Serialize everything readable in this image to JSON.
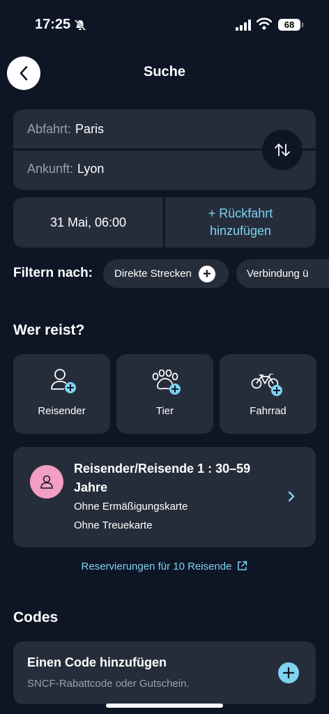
{
  "status_bar": {
    "time": "17:25",
    "battery": "68"
  },
  "header": {
    "title": "Suche"
  },
  "route": {
    "departure_label": "Abfahrt:",
    "departure_value": "Paris",
    "arrival_label": "Ankunft:",
    "arrival_value": "Lyon"
  },
  "date": {
    "outbound": "31 Mai, 06:00",
    "return_line1": "+ Rückfahrt",
    "return_line2": "hinzufügen"
  },
  "filters": {
    "label": "Filtern nach:",
    "chips": [
      "Direkte Strecken",
      "Verbindung ü"
    ]
  },
  "who": {
    "title": "Wer reist?",
    "options": [
      "Reisender",
      "Tier",
      "Fahrrad"
    ]
  },
  "traveler": {
    "name": "Reisender/Reisende 1 : 30–59 Jahre",
    "card1": "Ohne Ermäßigungskarte",
    "card2": "Ohne Treuekarte"
  },
  "reservation_link": "Reservierungen für 10 Reisende",
  "codes": {
    "title": "Codes",
    "add_title": "Einen Code hinzufügen",
    "add_sub": "SNCF-Rabattcode oder Gutschein."
  },
  "colors": {
    "background": "#0e1525",
    "card": "#262d3a",
    "accent": "#7dd3f0",
    "avatar": "#f39ec4"
  }
}
